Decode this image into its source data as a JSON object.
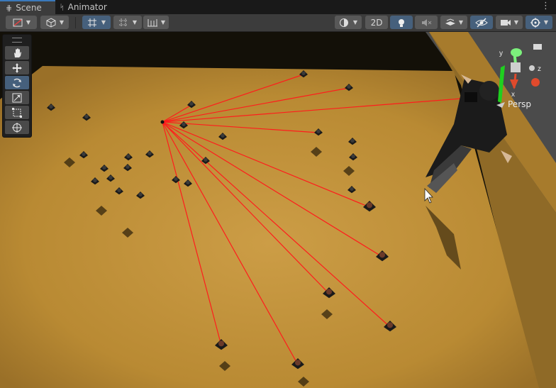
{
  "tabs": [
    {
      "label": "Scene",
      "icon": "grid-icon",
      "active": true
    },
    {
      "label": "Animator",
      "icon": "animator-icon",
      "active": false
    }
  ],
  "toolbar": {
    "two_d_label": "2D"
  },
  "tools": [
    "hand-tool",
    "move-tool",
    "rotate-tool",
    "scale-tool",
    "rect-tool",
    "transform-tool"
  ],
  "gizmo": {
    "projection_label": "Persp",
    "axes": {
      "x": "x",
      "y": "y",
      "z": "z"
    }
  },
  "colors": {
    "ground": "#b98a33",
    "ground_light": "#cc9d46",
    "ground_dark": "#7d5a1c",
    "void": "#131008",
    "sky": "#4b4b4b",
    "ray": "#ff1c1c",
    "accent": "#3a79bb",
    "gizmo_x": "#e04a2c",
    "gizmo_y": "#1fd01f",
    "gizmo_z": "#4a86e8"
  },
  "scene": {
    "ray_origin": [
      229,
      172
    ],
    "ray_targets": [
      [
        428,
        105
      ],
      [
        492,
        124
      ],
      [
        650,
        139
      ],
      [
        449,
        187
      ],
      [
        521,
        292
      ],
      [
        539,
        362
      ],
      [
        464,
        414
      ],
      [
        550,
        461
      ],
      [
        312,
        487
      ],
      [
        420,
        514
      ],
      [
        270,
        148
      ]
    ],
    "units": [
      [
        72,
        152
      ],
      [
        122,
        166
      ],
      [
        118,
        219
      ],
      [
        147,
        238
      ],
      [
        156,
        252
      ],
      [
        134,
        256
      ],
      [
        181,
        222
      ],
      [
        180,
        237
      ],
      [
        211,
        218
      ],
      [
        168,
        270
      ],
      [
        198,
        276
      ],
      [
        248,
        254
      ],
      [
        265,
        259
      ],
      [
        259,
        177
      ],
      [
        314,
        193
      ],
      [
        290,
        227
      ],
      [
        497,
        200
      ],
      [
        498,
        222
      ],
      [
        496,
        268
      ],
      [
        428,
        105
      ],
      [
        492,
        124
      ],
      [
        449,
        187
      ],
      [
        521,
        292
      ],
      [
        539,
        362
      ],
      [
        464,
        414
      ],
      [
        550,
        461
      ],
      [
        312,
        487
      ],
      [
        420,
        514
      ],
      [
        270,
        148
      ]
    ],
    "shadows": [
      [
        98,
        229
      ],
      [
        143,
        297
      ],
      [
        180,
        328
      ],
      [
        446,
        214
      ],
      [
        492,
        241
      ],
      [
        461,
        443
      ],
      [
        317,
        516
      ],
      [
        428,
        538
      ]
    ]
  }
}
